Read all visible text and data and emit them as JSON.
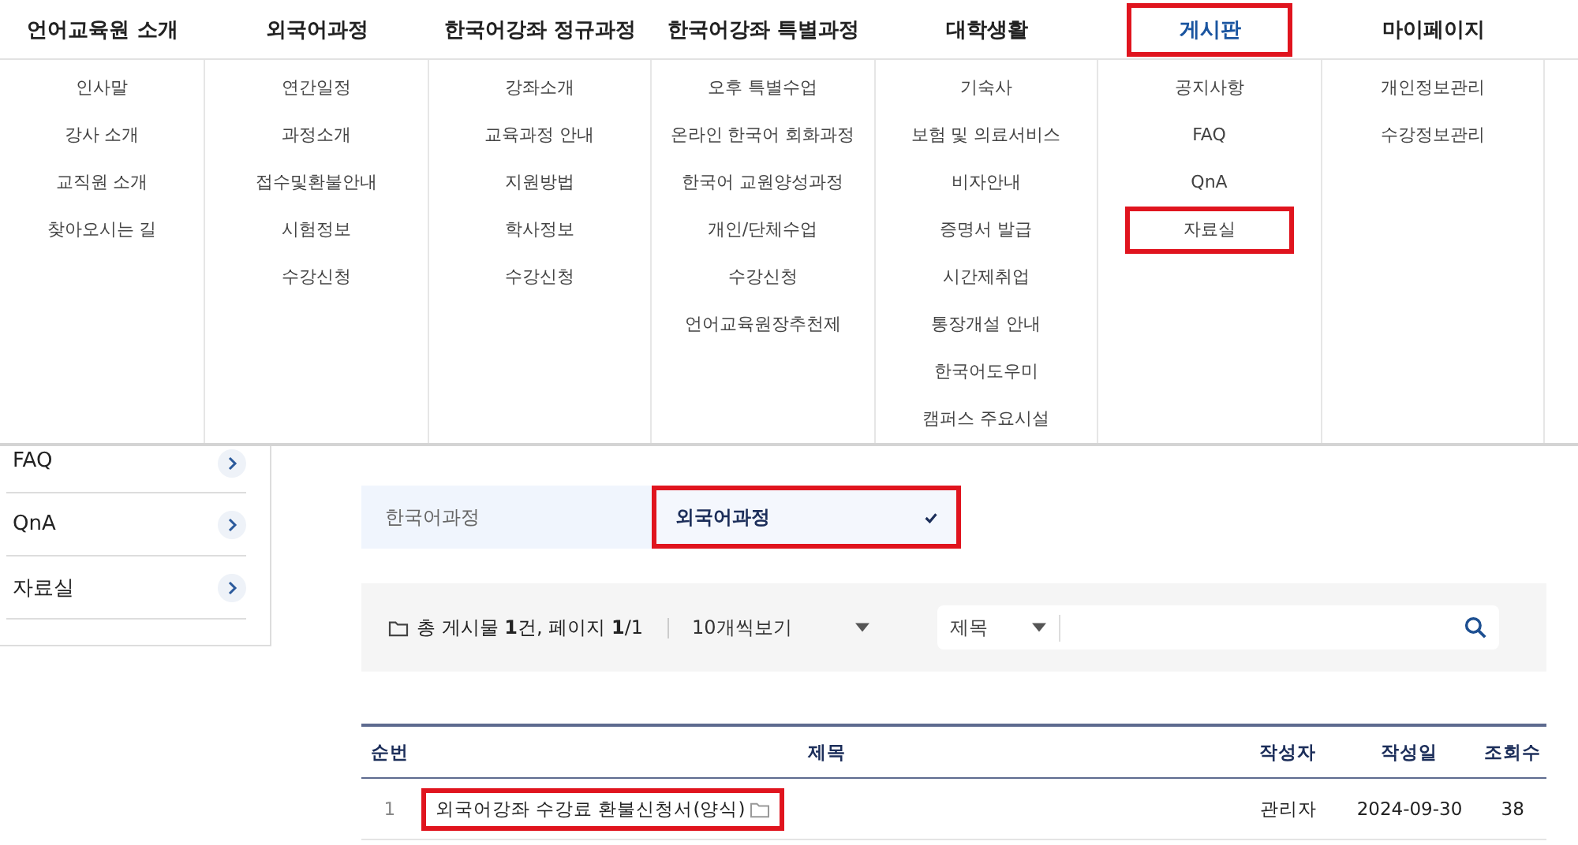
{
  "nav": [
    {
      "label": "언어교육원 소개",
      "selected": false,
      "highlighted": false,
      "children": [
        {
          "label": "인사말",
          "highlighted": false
        },
        {
          "label": "강사 소개",
          "highlighted": false
        },
        {
          "label": "교직원 소개",
          "highlighted": false
        },
        {
          "label": "찾아오시는 길",
          "highlighted": false
        }
      ]
    },
    {
      "label": "외국어과정",
      "selected": false,
      "highlighted": false,
      "children": [
        {
          "label": "연간일정",
          "highlighted": false
        },
        {
          "label": "과정소개",
          "highlighted": false
        },
        {
          "label": "접수및환불안내",
          "highlighted": false
        },
        {
          "label": "시험정보",
          "highlighted": false
        },
        {
          "label": "수강신청",
          "highlighted": false
        }
      ]
    },
    {
      "label": "한국어강좌 정규과정",
      "selected": false,
      "highlighted": false,
      "children": [
        {
          "label": "강좌소개",
          "highlighted": false
        },
        {
          "label": "교육과정 안내",
          "highlighted": false
        },
        {
          "label": "지원방법",
          "highlighted": false
        },
        {
          "label": "학사정보",
          "highlighted": false
        },
        {
          "label": "수강신청",
          "highlighted": false
        }
      ]
    },
    {
      "label": "한국어강좌 특별과정",
      "selected": false,
      "highlighted": false,
      "children": [
        {
          "label": "오후 특별수업",
          "highlighted": false
        },
        {
          "label": "온라인 한국어 회화과정",
          "highlighted": false
        },
        {
          "label": "한국어 교원양성과정",
          "highlighted": false
        },
        {
          "label": "개인/단체수업",
          "highlighted": false
        },
        {
          "label": "수강신청",
          "highlighted": false
        },
        {
          "label": "언어교육원장추천제",
          "highlighted": false
        }
      ]
    },
    {
      "label": "대학생활",
      "selected": false,
      "highlighted": false,
      "children": [
        {
          "label": "기숙사",
          "highlighted": false
        },
        {
          "label": "보험 및 의료서비스",
          "highlighted": false
        },
        {
          "label": "비자안내",
          "highlighted": false
        },
        {
          "label": "증명서 발급",
          "highlighted": false
        },
        {
          "label": "시간제취업",
          "highlighted": false
        },
        {
          "label": "통장개설 안내",
          "highlighted": false
        },
        {
          "label": "한국어도우미",
          "highlighted": false
        },
        {
          "label": "캠퍼스 주요시설",
          "highlighted": false
        }
      ]
    },
    {
      "label": "게시판",
      "selected": true,
      "highlighted": true,
      "children": [
        {
          "label": "공지사항",
          "highlighted": false
        },
        {
          "label": "FAQ",
          "highlighted": false
        },
        {
          "label": "QnA",
          "highlighted": false
        },
        {
          "label": "자료실",
          "highlighted": true
        }
      ]
    },
    {
      "label": "마이페이지",
      "selected": false,
      "highlighted": false,
      "children": [
        {
          "label": "개인정보관리",
          "highlighted": false
        },
        {
          "label": "수강정보관리",
          "highlighted": false
        }
      ]
    }
  ],
  "sidebar": {
    "items": [
      {
        "label": "FAQ"
      },
      {
        "label": "QnA"
      },
      {
        "label": "자료실"
      }
    ]
  },
  "tabs": [
    {
      "label": "한국어과정",
      "selected": false,
      "highlighted": false
    },
    {
      "label": "외국어과정",
      "selected": true,
      "highlighted": true
    }
  ],
  "board": {
    "summary": "총 게시물 **1**건, 페이지 **1**/1",
    "page_size": "10개씩보기",
    "search_field": "제목"
  },
  "table": {
    "columns": [
      "순번",
      "제목",
      "작성자",
      "작성일",
      "조회수"
    ],
    "rows": [
      {
        "number": "1",
        "title": "외국어강좌 수강료 환불신청서(양식)",
        "attachment": true,
        "highlighted": true,
        "author": "관리자",
        "date": "2024-09-30",
        "views": "38"
      }
    ]
  }
}
